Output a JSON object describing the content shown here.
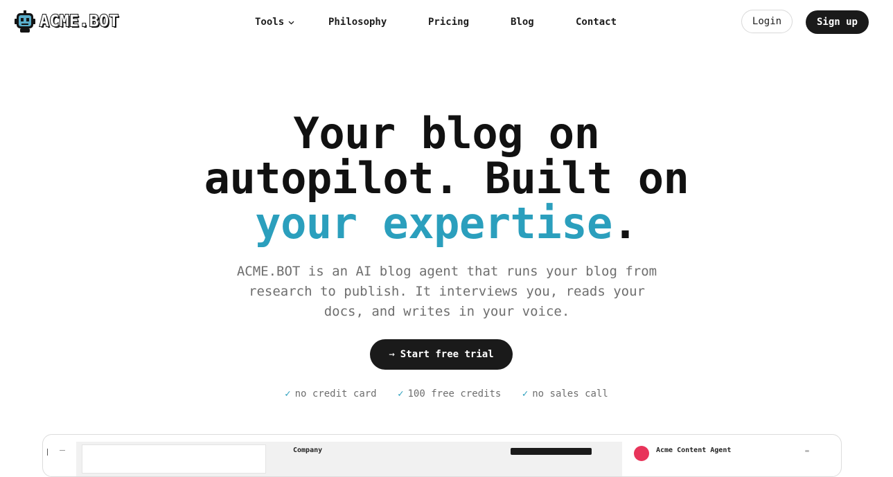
{
  "brand": {
    "name": "ACME.BOT",
    "accent_color": "#2b9fbd",
    "dark_color": "#1a1a1a"
  },
  "nav": {
    "items": [
      {
        "label": "Tools",
        "has_dropdown": true
      },
      {
        "label": "Philosophy"
      },
      {
        "label": "Pricing"
      },
      {
        "label": "Blog"
      },
      {
        "label": "Contact"
      }
    ],
    "login_label": "Login",
    "signup_label": "Sign up"
  },
  "hero": {
    "title_line1": "Your blog on",
    "title_line2": "autopilot. Built on",
    "title_accent": "your expertise",
    "title_end": ".",
    "subtitle": "ACME.BOT is an AI blog agent that runs your blog from research to publish. It interviews you, reads your docs, and writes in your voice.",
    "cta_label": "Start free trial",
    "cta_icon": "arrow-right-icon",
    "perks": [
      "no credit card",
      "100 free credits",
      "no sales call"
    ]
  },
  "preview": {
    "company_label": "Company",
    "agent_name": "Acme Content Agent"
  }
}
